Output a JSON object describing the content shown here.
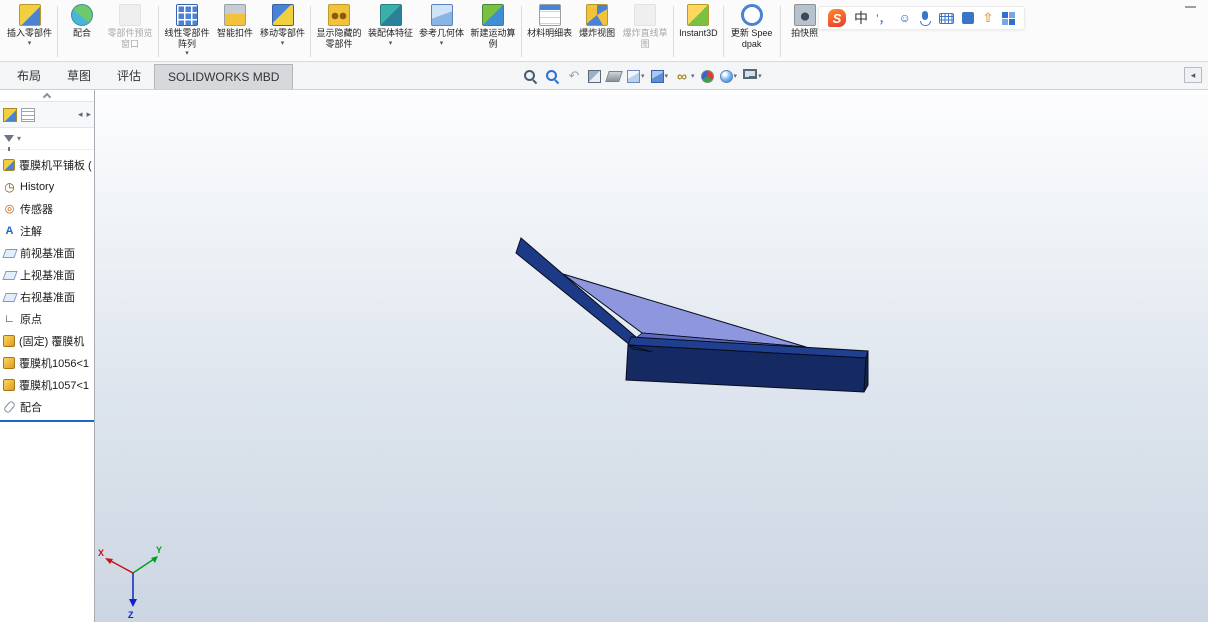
{
  "ribbon": {
    "buttons": [
      {
        "id": "insert-component",
        "label": "插入零部件",
        "icon": "insert-component-icon",
        "dropdown": true,
        "disabled": false,
        "group": 1
      },
      {
        "id": "mate",
        "label": "配合",
        "icon": "mate-icon",
        "dropdown": false,
        "disabled": false,
        "group": 2
      },
      {
        "id": "component-preview",
        "label": "零部件预览窗口",
        "icon": "component-preview-icon",
        "dropdown": false,
        "disabled": true,
        "group": 2
      },
      {
        "id": "linear-component-pattern",
        "label": "线性零部件阵列",
        "icon": "linear-pattern-icon",
        "dropdown": true,
        "disabled": false,
        "group": 3
      },
      {
        "id": "smart-fasteners",
        "label": "智能扣件",
        "icon": "smart-fasteners-icon",
        "dropdown": false,
        "disabled": false,
        "group": 3
      },
      {
        "id": "move-component",
        "label": "移动零部件",
        "icon": "move-component-icon",
        "dropdown": true,
        "disabled": false,
        "group": 3
      },
      {
        "id": "show-hidden-components",
        "label": "显示隐藏的零部件",
        "icon": "show-hidden-icon",
        "dropdown": false,
        "disabled": false,
        "group": 4
      },
      {
        "id": "assembly-features",
        "label": "装配体特征",
        "icon": "assembly-features-icon",
        "dropdown": true,
        "disabled": false,
        "group": 4
      },
      {
        "id": "reference-geometry",
        "label": "参考几何体",
        "icon": "reference-geometry-icon",
        "dropdown": true,
        "disabled": false,
        "group": 4
      },
      {
        "id": "new-motion-study",
        "label": "新建运动算例",
        "icon": "motion-study-icon",
        "dropdown": false,
        "disabled": false,
        "group": 4
      },
      {
        "id": "bill-of-materials",
        "label": "材料明细表",
        "icon": "bom-icon",
        "dropdown": false,
        "disabled": false,
        "group": 5
      },
      {
        "id": "exploded-view",
        "label": "爆炸视图",
        "icon": "exploded-view-icon",
        "dropdown": false,
        "disabled": false,
        "group": 5
      },
      {
        "id": "explode-line-sketch",
        "label": "爆炸直线草图",
        "icon": "explode-sketch-icon",
        "dropdown": false,
        "disabled": true,
        "group": 5
      },
      {
        "id": "instant3d",
        "label": "Instant3D",
        "icon": "instant3d-icon",
        "dropdown": false,
        "disabled": false,
        "group": 6
      },
      {
        "id": "update-speedpak",
        "label": "更新 Speedpak",
        "icon": "update-speedpak-icon",
        "dropdown": false,
        "disabled": false,
        "group": 7
      },
      {
        "id": "take-snapshot",
        "label": "拍快照",
        "icon": "snapshot-icon",
        "dropdown": false,
        "disabled": false,
        "group": 8
      }
    ]
  },
  "ime": {
    "items": [
      {
        "name": "sogou-logo-icon",
        "glyph": "S"
      },
      {
        "name": "ime-lang-icon",
        "glyph": "中"
      },
      {
        "name": "ime-punctuation-icon",
        "glyph": "’，"
      },
      {
        "name": "ime-emoji-icon",
        "glyph": "☺"
      },
      {
        "name": "ime-mic-icon",
        "glyph": ""
      },
      {
        "name": "ime-keyboard-icon",
        "glyph": ""
      },
      {
        "name": "ime-tools-icon",
        "glyph": ""
      },
      {
        "name": "ime-skin-icon",
        "glyph": "⇧"
      },
      {
        "name": "ime-grid-icon",
        "glyph": ""
      }
    ]
  },
  "tabs": [
    {
      "id": "layout",
      "label": "布局",
      "active": false
    },
    {
      "id": "sketch",
      "label": "草图",
      "active": false
    },
    {
      "id": "evaluate",
      "label": "评估",
      "active": false
    },
    {
      "id": "solidworks-mbd",
      "label": "SOLIDWORKS MBD",
      "active": true
    }
  ],
  "viewbar": [
    {
      "id": "zoom-fit",
      "name": "zoom-fit-icon",
      "kind": "mag",
      "glyph": "",
      "dropdown": false
    },
    {
      "id": "zoom-area",
      "name": "zoom-area-icon",
      "kind": "mag2",
      "glyph": "",
      "dropdown": false
    },
    {
      "id": "previous-view",
      "name": "previous-view-icon",
      "kind": "prev",
      "glyph": "↶",
      "dropdown": false
    },
    {
      "id": "section-view",
      "name": "section-view-icon",
      "kind": "section",
      "glyph": "",
      "dropdown": false
    },
    {
      "id": "annotation-3d-view",
      "name": "annotation-3d-view-icon",
      "kind": "wedge",
      "glyph": "",
      "dropdown": false
    },
    {
      "id": "view-orientation",
      "name": "view-orientation-icon",
      "kind": "cube",
      "glyph": "",
      "dropdown": true
    },
    {
      "id": "display-style",
      "name": "display-style-icon",
      "kind": "cube2",
      "glyph": "",
      "dropdown": true
    },
    {
      "id": "hide-show-items",
      "name": "hide-show-items-icon",
      "kind": "glasses",
      "glyph": "∞",
      "dropdown": true
    },
    {
      "id": "edit-appearance",
      "name": "edit-appearance-icon",
      "kind": "ball",
      "glyph": "",
      "dropdown": false
    },
    {
      "id": "apply-scene",
      "name": "apply-scene-icon",
      "kind": "ball2",
      "glyph": "",
      "dropdown": true
    },
    {
      "id": "view-settings",
      "name": "view-settings-icon",
      "kind": "mon",
      "glyph": "",
      "dropdown": true
    }
  ],
  "panel": {
    "tab_icons": [
      {
        "name": "featuremanager-tab-icon",
        "glyph": ""
      },
      {
        "name": "display-pane-icon",
        "glyph": ""
      },
      {
        "name": "tab-scroll-left-icon",
        "glyph": "◂"
      },
      {
        "name": "tab-scroll-right-icon",
        "glyph": "▸"
      }
    ]
  },
  "tree": {
    "items": [
      {
        "id": "root",
        "icon": "assembly-icon",
        "glyph": "",
        "label": "覆膜机平铺板 ("
      },
      {
        "id": "history",
        "icon": "history-icon",
        "glyph": "◷",
        "label": "History"
      },
      {
        "id": "sensors",
        "icon": "sensors-icon",
        "glyph": "◎",
        "label": "传感器"
      },
      {
        "id": "annotations",
        "icon": "annotations-icon",
        "glyph": "A",
        "label": "注解"
      },
      {
        "id": "front-plane",
        "icon": "plane-icon",
        "glyph": "",
        "label": "前视基准面"
      },
      {
        "id": "top-plane",
        "icon": "plane-icon",
        "glyph": "",
        "label": "上视基准面"
      },
      {
        "id": "right-plane",
        "icon": "plane-icon",
        "glyph": "",
        "label": "右视基准面"
      },
      {
        "id": "origin",
        "icon": "origin-icon",
        "glyph": "∟",
        "label": "原点"
      },
      {
        "id": "component-fixed",
        "icon": "component-icon",
        "glyph": "",
        "label": "(固定) 覆膜机"
      },
      {
        "id": "component-1056",
        "icon": "component-icon",
        "glyph": "",
        "label": "覆膜机1056<1"
      },
      {
        "id": "component-1057",
        "icon": "component-icon",
        "glyph": "",
        "label": "覆膜机1057<1"
      },
      {
        "id": "mates",
        "icon": "mates-icon",
        "glyph": "",
        "label": "配合"
      }
    ]
  },
  "triad": {
    "x_label": "X",
    "y_label": "Y",
    "z_label": "Z"
  },
  "colors": {
    "accent": "#1a66cc",
    "model_dark": "#132552",
    "model_mid": "#1d3a86",
    "model_top": "#20408f",
    "model_front": "#152a63",
    "model_web": "#8e97dd",
    "model_web_edge": "#5f6abf",
    "model_outline": "#070c1f",
    "axis_x": "#cc1111",
    "axis_y": "#00a023",
    "axis_z": "#1122cc"
  }
}
